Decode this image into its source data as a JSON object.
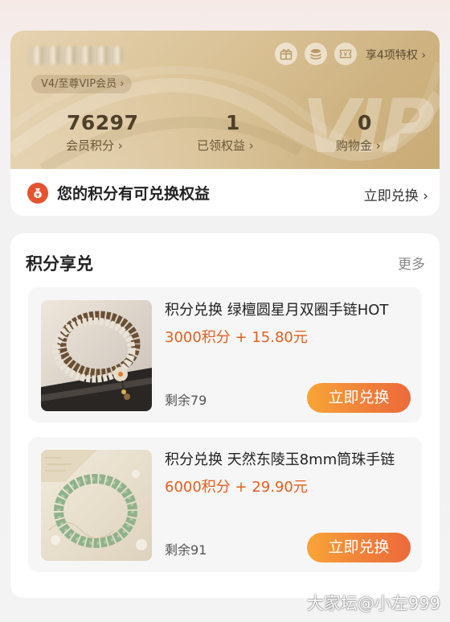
{
  "vip_card": {
    "level_badge": "V4/至尊VIP会员 ›",
    "perk_icons": [
      "gift-icon",
      "coins-icon",
      "coupon-icon"
    ],
    "perks_link": "享4项特权 ›",
    "watermark": "VIP",
    "stats": [
      {
        "value": "76297",
        "label": "会员积分 ›"
      },
      {
        "value": "1",
        "label": "已领权益 ›"
      },
      {
        "value": "0",
        "label": "购物金 ›"
      }
    ]
  },
  "notice": {
    "icon": "money-bag-icon",
    "text": "您的积分有可兑换权益",
    "link": "立即兑换 ›"
  },
  "exchange": {
    "title": "积分享兑",
    "more": "更多",
    "products": [
      {
        "name": "积分兑换 绿檀圆星月双圈手链HOT",
        "price": "3000积分 + 15.80元",
        "stock": "剩余79",
        "button": "立即兑换"
      },
      {
        "name": "积分兑换 天然东陵玉8mm筒珠手链",
        "price": "6000积分 + 29.90元",
        "stock": "剩余91",
        "button": "立即兑换"
      }
    ]
  },
  "site_watermark": "大家坛@小左999",
  "colors": {
    "accent_orange": "#e0601f",
    "button_gradient_start": "#f7a536",
    "button_gradient_end": "#ec6a3a",
    "vip_gold": "#d9c195",
    "notice_icon_red": "#e5532f"
  }
}
